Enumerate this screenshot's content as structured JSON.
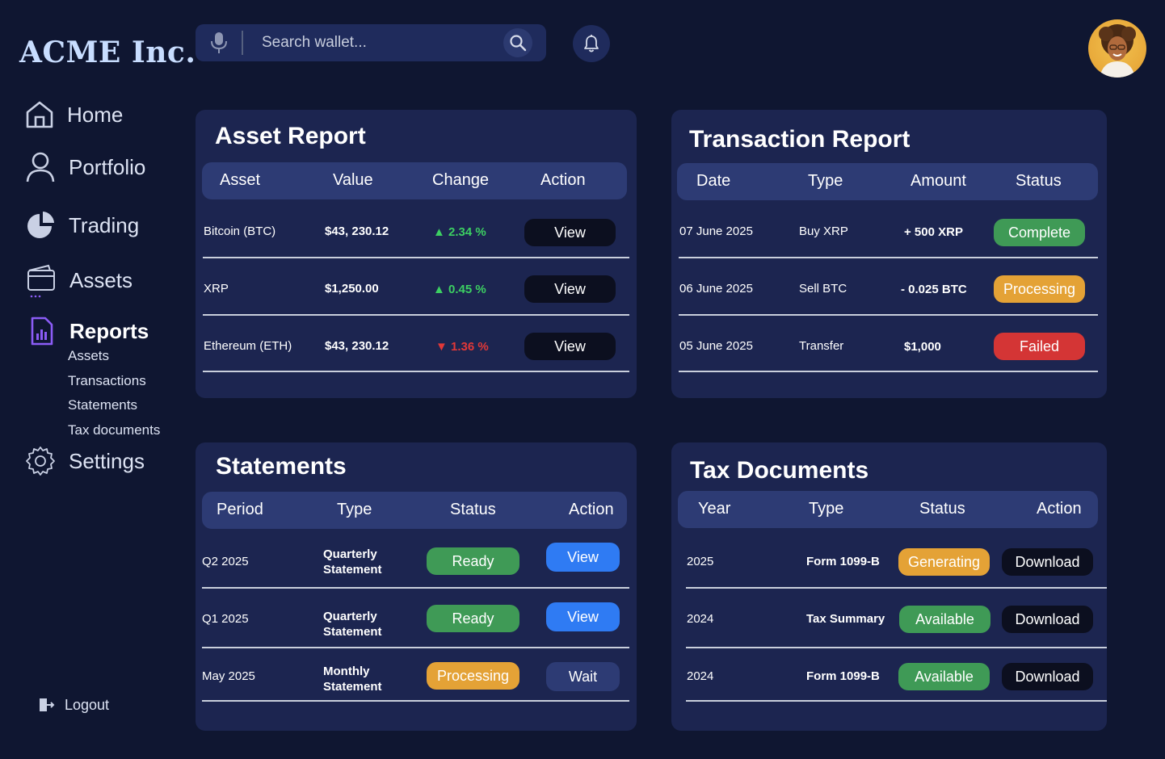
{
  "app": {
    "logo": "ACME Inc."
  },
  "search": {
    "placeholder": "Search wallet..."
  },
  "sidebar": {
    "items": [
      {
        "label": "Home",
        "icon": "home-icon"
      },
      {
        "label": "Portfolio",
        "icon": "user-icon"
      },
      {
        "label": "Trading",
        "icon": "pie-chart-icon"
      },
      {
        "label": "Assets",
        "icon": "wallet-icon"
      },
      {
        "label": "Reports",
        "icon": "report-icon"
      },
      {
        "label": "Settings",
        "icon": "gear-icon"
      }
    ],
    "report_sub": [
      "Assets",
      "Transactions",
      "Statements",
      "Tax documents"
    ],
    "logout": "Logout"
  },
  "asset_report": {
    "title": "Asset Report",
    "headers": [
      "Asset",
      "Value",
      "Change",
      "Action"
    ],
    "rows": [
      {
        "asset": "Bitcoin (BTC)",
        "value": "$43, 230.12",
        "change": "2.34 %",
        "direction": "up",
        "action": "View"
      },
      {
        "asset": "XRP",
        "value": "$1,250.00",
        "change": "0.45 %",
        "direction": "up",
        "action": "View"
      },
      {
        "asset": "Ethereum (ETH)",
        "value": "$43, 230.12",
        "change": "1.36 %",
        "direction": "down",
        "action": "View"
      }
    ]
  },
  "transaction_report": {
    "title": "Transaction Report",
    "headers": [
      "Date",
      "Type",
      "Amount",
      "Status"
    ],
    "rows": [
      {
        "date": "07 June 2025",
        "type": "Buy XRP",
        "amount": "+ 500 XRP",
        "status": "Complete",
        "status_color": "#3f9a56"
      },
      {
        "date": "06 June 2025",
        "type": "Sell BTC",
        "amount": "- 0.025 BTC",
        "status": "Processing",
        "status_color": "#e4a236"
      },
      {
        "date": "05 June 2025",
        "type": "Transfer",
        "amount": "$1,000",
        "status": "Failed",
        "status_color": "#d43535"
      }
    ]
  },
  "statements": {
    "title": "Statements",
    "headers": [
      "Period",
      "Type",
      "Status",
      "Action"
    ],
    "rows": [
      {
        "period": "Q2 2025",
        "type_line1": "Quarterly",
        "type_line2": "Statement",
        "status": "Ready",
        "action": "View"
      },
      {
        "period": "Q1 2025",
        "type_line1": "Quarterly",
        "type_line2": "Statement",
        "status": "Ready",
        "action": "View"
      },
      {
        "period": "May 2025",
        "type_line1": "Monthly",
        "type_line2": "Statement",
        "status": "Processing",
        "action": "Wait"
      }
    ]
  },
  "tax_documents": {
    "title": "Tax Documents",
    "headers": [
      "Year",
      "Type",
      "Status",
      "Action"
    ],
    "rows": [
      {
        "year": "2025",
        "type": "Form 1099-B",
        "status": "Generating",
        "action": "Download"
      },
      {
        "year": "2024",
        "type": "Tax Summary",
        "status": "Available",
        "action": "Download"
      },
      {
        "year": "2024",
        "type": "Form 1099-B",
        "status": "Available",
        "action": "Download"
      }
    ]
  },
  "colors": {
    "background": "#0f1631",
    "card": "#1c2550",
    "header": "#2d3b74",
    "accent_blue": "#2f7bf3",
    "green": "#3f9a56",
    "orange": "#e4a236",
    "red": "#d43535",
    "reports_icon": "#8b5cf6"
  }
}
